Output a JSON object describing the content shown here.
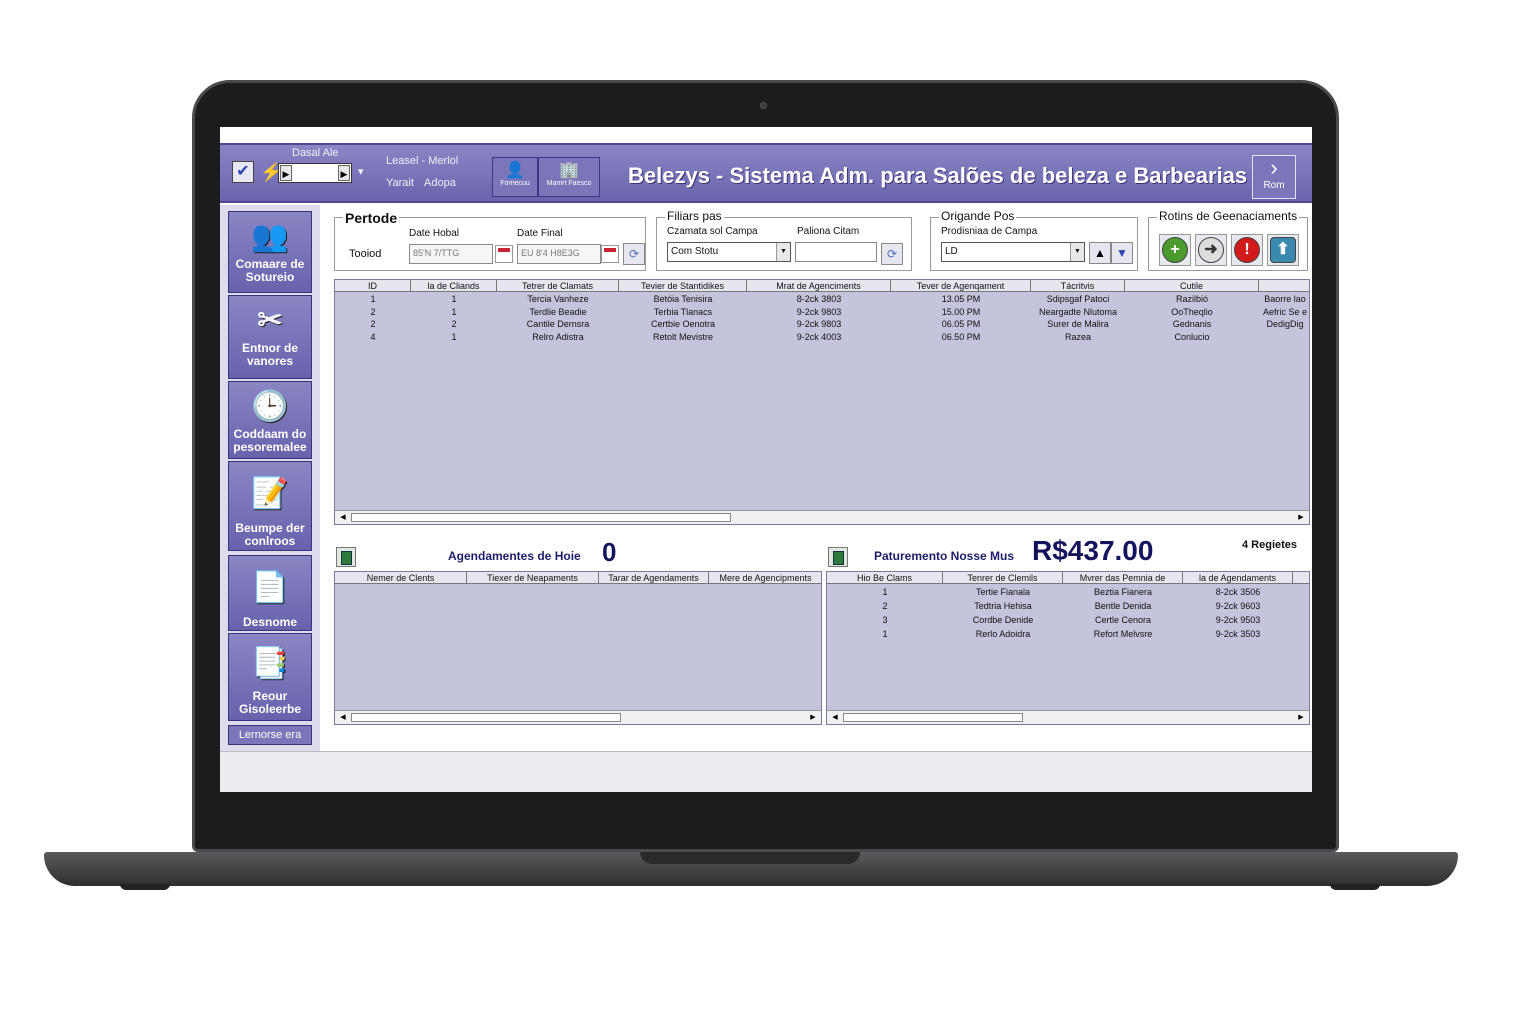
{
  "header": {
    "title": "Belezys - Sistema Adm. para Salões de beleza e Barbearias",
    "date_label": "Dasal Ale",
    "label_top": "Leasel - Merlol",
    "label_left": "Yarait",
    "label_right": "Adopa",
    "btn1_label": "Fornecuu",
    "btn2_label": "Mamrt Faesco",
    "exit_label": "Rom"
  },
  "sidebar": {
    "items": [
      {
        "label": "Comaare de Sotureio",
        "icon": "people-group-icon"
      },
      {
        "label": "Entnor de vanores",
        "icon": "scissors-icon"
      },
      {
        "label": "Coddaam do pesoremalee",
        "icon": "clock-document-icon"
      },
      {
        "label": "Beumpe der conlroos",
        "icon": "notepad-pen-icon"
      },
      {
        "label": "Desnome",
        "icon": "document-stack-icon"
      },
      {
        "label": "Reour Gisoleerbe",
        "icon": "documents-icon"
      }
    ],
    "footer": "Lernorse era"
  },
  "periodo": {
    "title": "Pertode",
    "sub": "Tooiod",
    "date_start_label": "Date Hobal",
    "date_start_value": "85'N 7/TTG",
    "date_end_label": "Date Final",
    "date_end_value": "EU 8'4 H8E3G"
  },
  "filtros": {
    "title": "Filiars pas",
    "campo_label": "Czamata sol Campa",
    "campo_value": "Com Stotu",
    "palavra_label": "Paliona Citam",
    "palavra_value": ""
  },
  "ordenacao": {
    "title": "Origande Pos",
    "label": "Prodisniaa de Campa",
    "value": "LD"
  },
  "rotinas": {
    "title": "Rotins de Geenaciaments"
  },
  "main_table": {
    "columns": [
      "ID",
      "la de Cliands",
      "Tetrer de Clamats",
      "Tevier de Stantidikes",
      "Mrat de Agenciments",
      "Tever de Agenqament",
      "Tácritvis",
      "Cutile",
      ""
    ],
    "rows": [
      [
        "1",
        "1",
        "Tercia Vanheze",
        "Betóia Tenisira",
        "8-2ck 3803",
        "13.05 PM",
        "Sdipsgaf Patoci",
        "Razilbió",
        "Baorre lao"
      ],
      [
        "2",
        "1",
        "Terdlie Beadie",
        "Terbia Tlanacs",
        "9-2ck 9803",
        "15.00 PM",
        "Neargadte Nlutoma",
        "OoTheqlio",
        "Aefric Se e"
      ],
      [
        "2",
        "2",
        "Cantile Dernsra",
        "Certbie Oenotra",
        "9-2ck 9803",
        "06.05 PM",
        "Surer de Malira",
        "Gednanis",
        "DedigDig"
      ],
      [
        "4",
        "1",
        "Relro Adistra",
        "Retolt Mevistre",
        "9-2ck 4003",
        "06.50 PM",
        "Razea",
        "Conlucio",
        ""
      ]
    ]
  },
  "today": {
    "label": "Agendamentes de Hoie",
    "value": "0",
    "columns": [
      "Nemer de Clents",
      "Tiexer de Neapaments",
      "Tarar de Agendaments",
      "Mere de Agencipments"
    ]
  },
  "revenue": {
    "label": "Paturemento Nosse Mus",
    "value": "R$437.00",
    "count": "4 Regietes",
    "columns": [
      "Hio Be Clams",
      "Tenrer de Clemils",
      "Mvrer das Pemnia de",
      "la de Agendaments"
    ],
    "rows": [
      [
        "1",
        "Tertie Fianala",
        "Beztia Fianera",
        "8-2ck 3506"
      ],
      [
        "2",
        "Tedtria Hehisa",
        "Bentle Denida",
        "9-2ck 9603"
      ],
      [
        "3",
        "Cordbe Denide",
        "Certle Cenora",
        "9-2ck 9503"
      ],
      [
        "1",
        "Rerlo Adoidra",
        "Refort Melvsre",
        "9-2ck 3503"
      ]
    ]
  },
  "colors": {
    "header_purple": "#6a64ad",
    "grid_lavender": "#c4c4dc",
    "value_navy": "#14145e"
  }
}
